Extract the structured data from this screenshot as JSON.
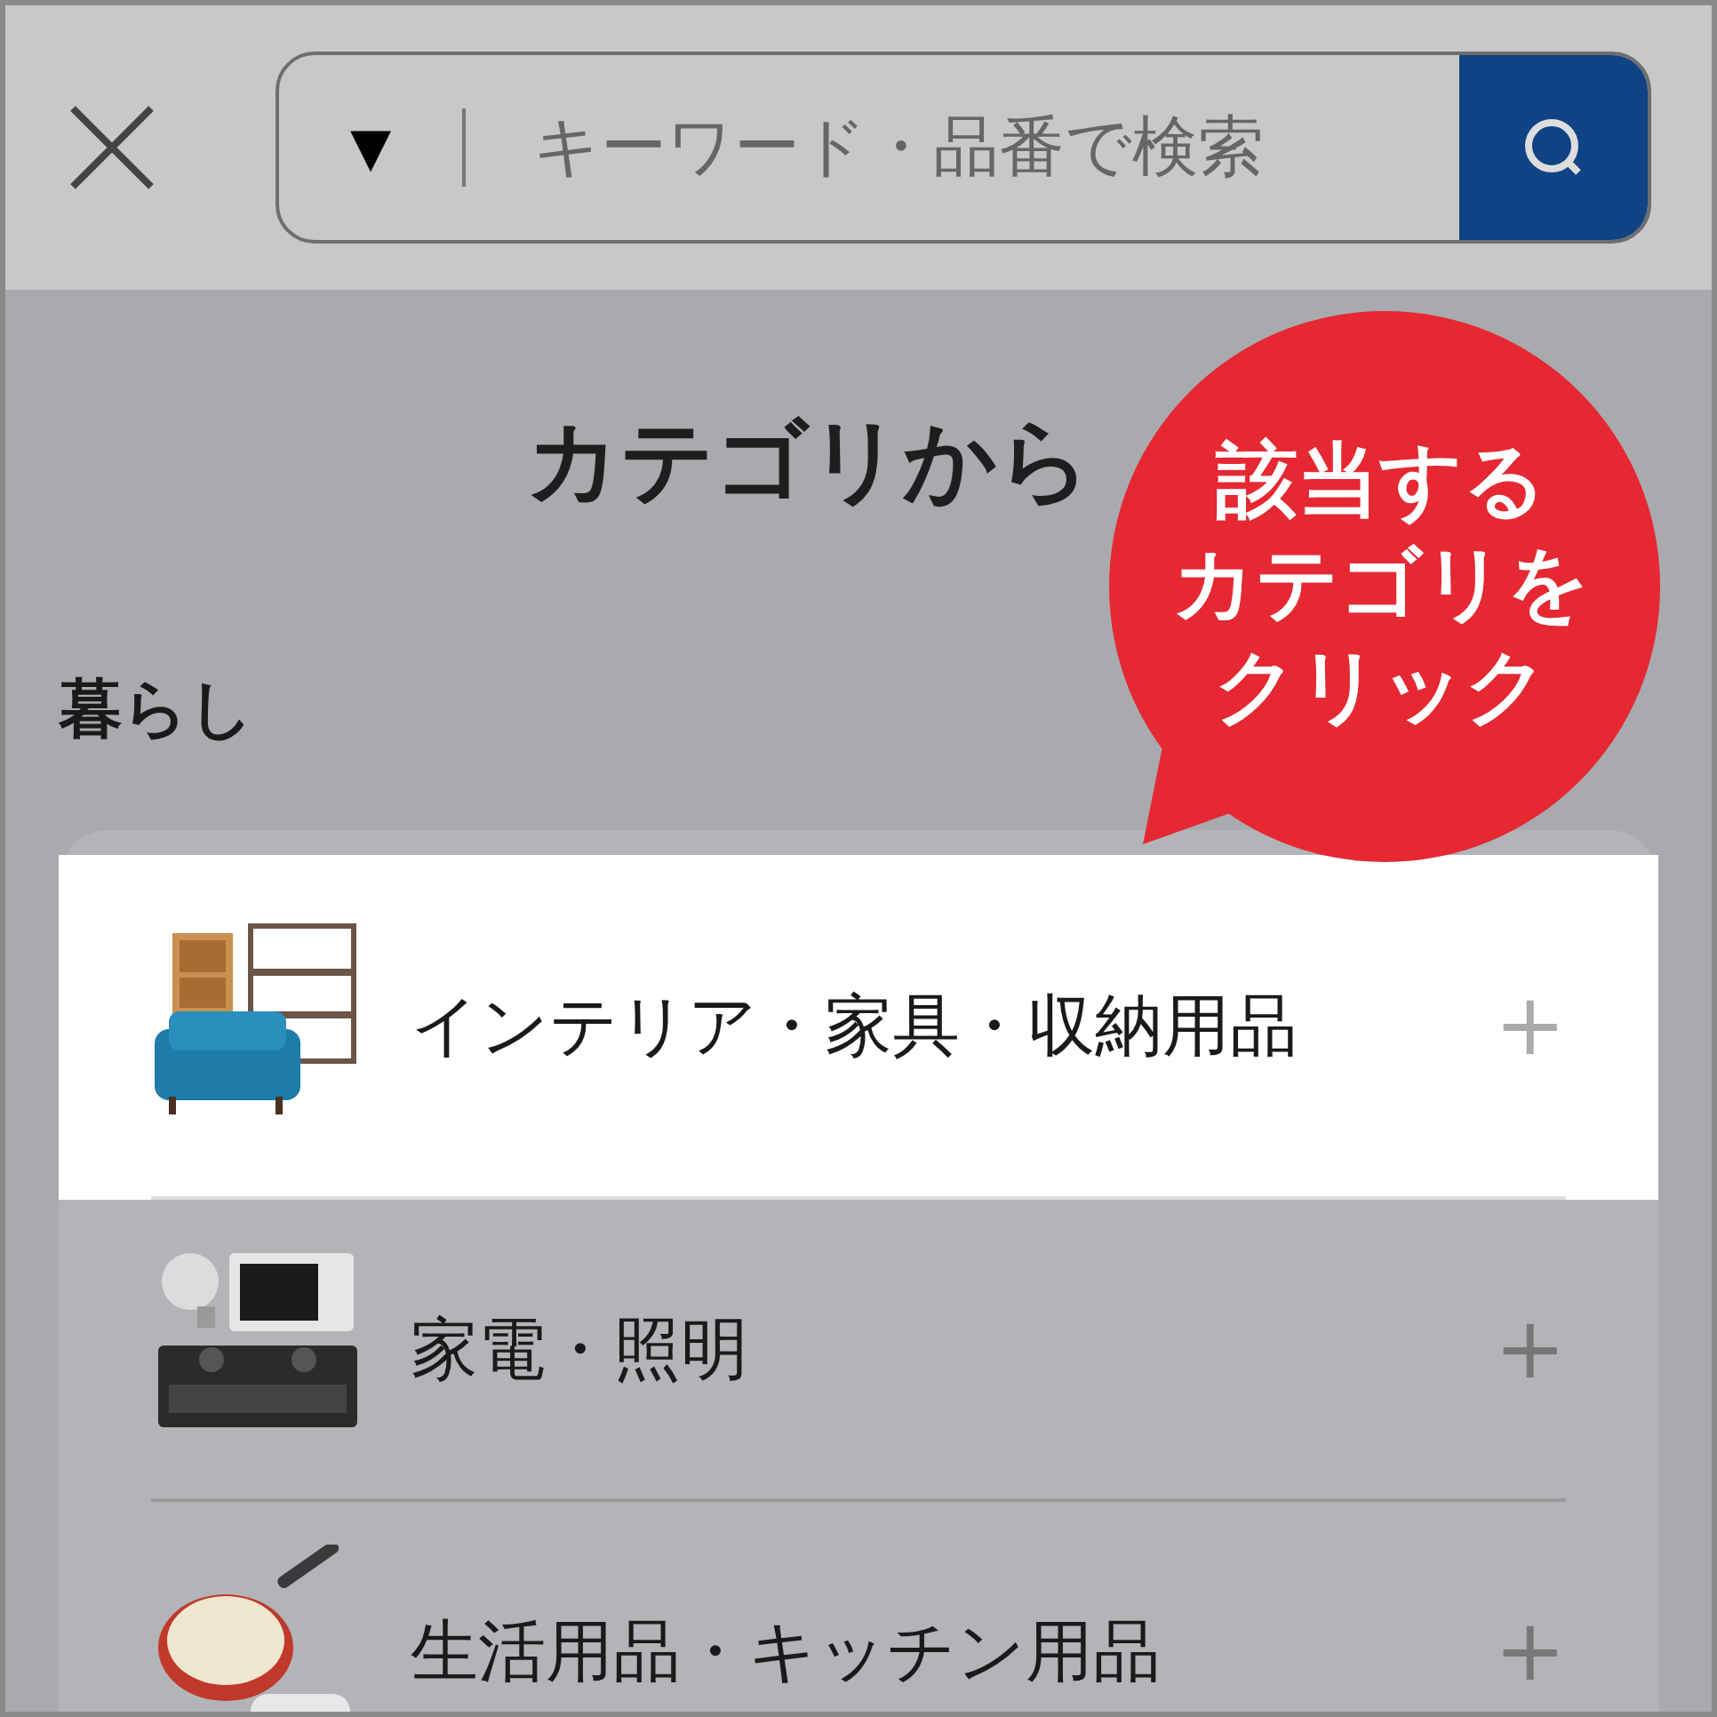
{
  "search": {
    "scope": "▼",
    "placeholder": "キーワード・品番で検索"
  },
  "heading": "カテゴリから",
  "section": "暮らし",
  "categories": [
    {
      "label": "インテリア・家具・収納用品",
      "selected": true,
      "expand": "+"
    },
    {
      "label": "家電・照明",
      "selected": false,
      "expand": "+"
    },
    {
      "label": "生活用品・キッチン用品",
      "selected": false,
      "expand": "+"
    }
  ],
  "callout": {
    "lines": [
      "該当する",
      "カテゴリを",
      "クリック"
    ]
  }
}
